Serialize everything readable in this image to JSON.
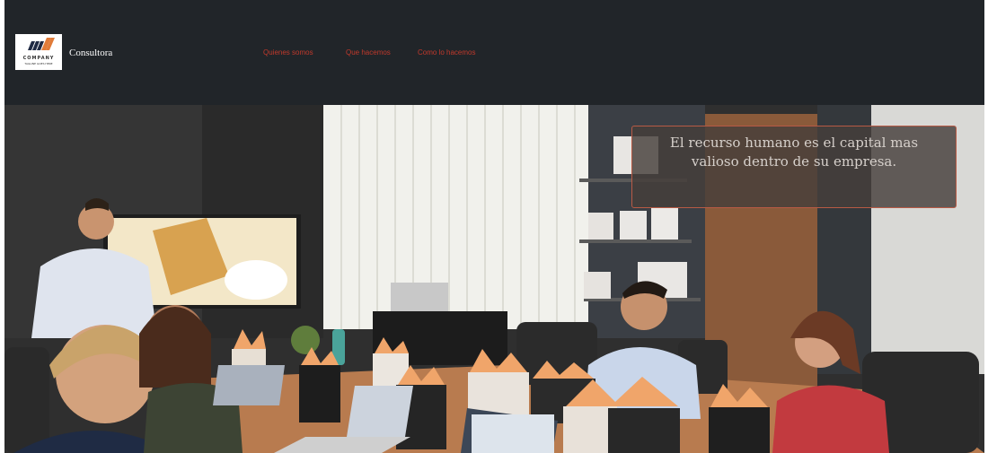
{
  "brand": {
    "logo_icon": "company-logo-icon",
    "logo_word": "COMPANY",
    "logo_tagline": "TAGLINE GOES HERE",
    "name": "Consultora"
  },
  "nav": {
    "items": [
      {
        "label": "Quienes somos"
      },
      {
        "label": "Que hacemos"
      },
      {
        "label": "Como lo hacemos"
      }
    ]
  },
  "hero": {
    "quote": "El recurso humano es el capital mas valioso dentro de su empresa."
  },
  "colors": {
    "navbar_bg": "#212529",
    "nav_link": "#c0392b",
    "quote_border": "#b85a45"
  }
}
